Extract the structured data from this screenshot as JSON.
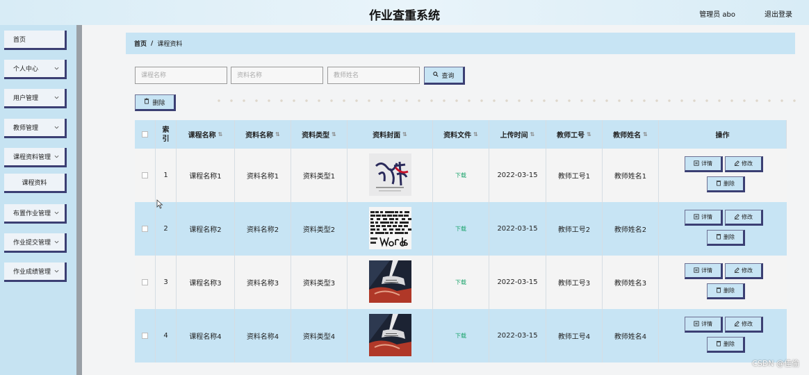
{
  "header": {
    "title": "作业查重系统",
    "user": "管理员 abo",
    "logout": "退出登录"
  },
  "sidebar": {
    "items": [
      {
        "label": "首页",
        "chevron": false
      },
      {
        "label": "个人中心",
        "chevron": true
      },
      {
        "label": "用户管理",
        "chevron": true
      },
      {
        "label": "教师管理",
        "chevron": true
      },
      {
        "label": "课程资料管理",
        "chevron": true
      },
      {
        "label": "课程资料",
        "chevron": false,
        "sub": true
      },
      {
        "label": "布置作业管理",
        "chevron": true
      },
      {
        "label": "作业提交管理",
        "chevron": true
      },
      {
        "label": "作业成绩管理",
        "chevron": true
      }
    ]
  },
  "breadcrumb": {
    "home": "首页",
    "separator": "/",
    "current": "课程资料"
  },
  "search": {
    "course_placeholder": "课程名称",
    "material_placeholder": "资料名称",
    "teacher_placeholder": "教师姓名",
    "query_label": "查询"
  },
  "toolbar": {
    "delete_label": "删除"
  },
  "table": {
    "columns": [
      "",
      "索引",
      "课程名称",
      "资料名称",
      "资料类型",
      "资料封面",
      "资料文件",
      "上传时间",
      "教师工号",
      "教师姓名",
      "操作"
    ],
    "rows": [
      {
        "index": "1",
        "course": "课程名称1",
        "material": "资料名称1",
        "type": "资料类型1",
        "cover": "calligraphy",
        "file": "下载",
        "time": "2022-03-15",
        "teacher_id": "教师工号1",
        "teacher_name": "教师姓名1"
      },
      {
        "index": "2",
        "course": "课程名称2",
        "material": "资料名称2",
        "type": "资料类型2",
        "cover": "words",
        "file": "下载",
        "time": "2022-03-15",
        "teacher_id": "教师工号2",
        "teacher_name": "教师姓名2"
      },
      {
        "index": "3",
        "course": "课程名称3",
        "material": "资料名称3",
        "type": "资料类型3",
        "cover": "writing",
        "file": "下载",
        "time": "2022-03-15",
        "teacher_id": "教师工号3",
        "teacher_name": "教师姓名3"
      },
      {
        "index": "4",
        "course": "课程名称4",
        "material": "资料名称4",
        "type": "资料类型4",
        "cover": "writing",
        "file": "下载",
        "time": "2022-03-15",
        "teacher_id": "教师工号4",
        "teacher_name": "教师姓名4"
      }
    ],
    "actions": {
      "detail": "详情",
      "edit": "修改",
      "delete": "删除"
    }
  },
  "icons": {
    "search": "search-icon",
    "delete": "trash-icon",
    "detail": "detail-icon",
    "edit": "edit-icon",
    "chevron": "chevron-down-icon"
  },
  "watermark": "CSDN @佳偷",
  "colors": {
    "accent": "#c7e4f4",
    "border": "#3b3f73",
    "download": "#1aa36b"
  }
}
